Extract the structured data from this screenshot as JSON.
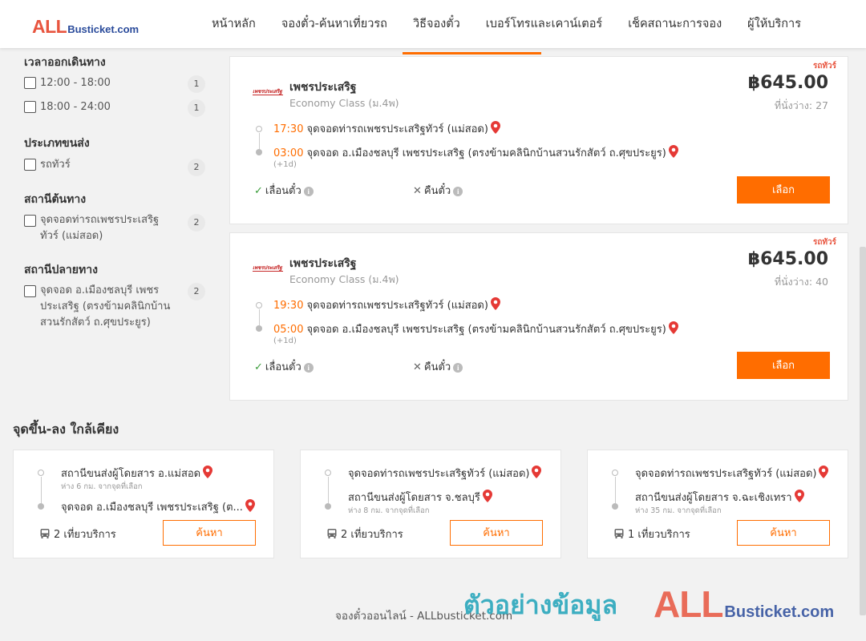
{
  "header": {
    "logo_all": "ALL",
    "logo_rest": "Busticket.com",
    "nav": [
      "หน้าหลัก",
      "จองตั๋ว-ค้นหาเที่ยวรถ",
      "วิธีจองตั๋ว",
      "เบอร์โทรและเคาน์เตอร์",
      "เช็คสถานะการจอง",
      "ผู้ให้บริการ"
    ]
  },
  "filters": {
    "departure_time": {
      "title": "เวลาออกเดินทาง",
      "options": [
        {
          "label": "12:00 - 18:00",
          "count": "1"
        },
        {
          "label": "18:00 - 24:00",
          "count": "1"
        }
      ]
    },
    "vehicle_type": {
      "title": "ประเภทขนส่ง",
      "options": [
        {
          "label": "รถทัวร์",
          "count": "2"
        }
      ]
    },
    "origin": {
      "title": "สถานีต้นทาง",
      "options": [
        {
          "label": "จุดจอดท่ารถเพชรประเสริฐทัวร์ (แม่สอด)",
          "count": "2"
        }
      ]
    },
    "destination": {
      "title": "สถานีปลายทาง",
      "options": [
        {
          "label": "จุดจอด อ.เมืองชลบุรี เพชรประเสริฐ (ตรงข้ามคลินิกบ้านสวนรักสัตว์ ถ.ศุขประยูร)",
          "count": "2"
        }
      ]
    }
  },
  "trips": [
    {
      "badge": "รถทัวร์",
      "operator_logo": "เพชรประเสริฐ",
      "operator": "เพชรประเสริฐ",
      "bus_class": "Economy Class (ม.4พ)",
      "price": "฿645.00",
      "seats": "ที่นั่งว่าง: 27",
      "depart_time": "17:30",
      "depart_stop": "จุดจอดท่ารถเพชรประเสริฐทัวร์ (แม่สอด)",
      "arrive_time": "03:00",
      "arrive_stop": "จุดจอด อ.เมืองชลบุรี เพชรประเสริฐ (ตรงข้ามคลินิกบ้านสวนรักสัตว์ ถ.ศุขประยูร)",
      "plus_day": "(+1d)",
      "reschedule": "เลื่อนตั๋ว",
      "refund": "คืนตั๋ว",
      "select": "เลือก"
    },
    {
      "badge": "รถทัวร์",
      "operator_logo": "เพชรประเสริฐ",
      "operator": "เพชรประเสริฐ",
      "bus_class": "Economy Class (ม.4พ)",
      "price": "฿645.00",
      "seats": "ที่นั่งว่าง: 40",
      "depart_time": "19:30",
      "depart_stop": "จุดจอดท่ารถเพชรประเสริฐทัวร์ (แม่สอด)",
      "arrive_time": "05:00",
      "arrive_stop": "จุดจอด อ.เมืองชลบุรี เพชรประเสริฐ (ตรงข้ามคลินิกบ้านสวนรักสัตว์ ถ.ศุขประยูร)",
      "plus_day": "(+1d)",
      "reschedule": "เลื่อนตั๋ว",
      "refund": "คืนตั๋ว",
      "select": "เลือก"
    }
  ],
  "nearby": {
    "title": "จุดขึ้น-ลง ใกล้เคียง",
    "cards": [
      {
        "from": "สถานีขนส่งผู้โดยสาร อ.แม่สอด",
        "from_dist": "ห่าง 6 กม. จากจุดที่เลือก",
        "to": "จุดจอด อ.เมืองชลบุรี เพชรประเสริฐ (ต...",
        "to_dist": "",
        "trips": "2 เที่ยวบริการ",
        "button": "ค้นหา"
      },
      {
        "from": "จุดจอดท่ารถเพชรประเสริฐทัวร์ (แม่สอด)",
        "from_dist": "",
        "to": "สถานีขนส่งผู้โดยสาร จ.ชลบุรี",
        "to_dist": "ห่าง 8 กม. จากจุดที่เลือก",
        "trips": "2 เที่ยวบริการ",
        "button": "ค้นหา"
      },
      {
        "from": "จุดจอดท่ารถเพชรประเสริฐทัวร์ (แม่สอด)",
        "from_dist": "",
        "to": "สถานีขนส่งผู้โดยสาร จ.ฉะเชิงเทรา",
        "to_dist": "ห่าง 35 กม. จากจุดที่เลือก",
        "trips": "1 เที่ยวบริการ",
        "button": "ค้นหา"
      }
    ]
  },
  "footer": {
    "text": "จองตั๋วออนไลน์ - ALLbusticket.com",
    "watermark_sample": "ตัวอย่างข้อมูล",
    "watermark_all": "ALL",
    "watermark_rest": "Busticket.com"
  },
  "colors": {
    "accent": "#ff6d00",
    "brand_red": "#e8553f",
    "brand_blue": "#2a4b9b",
    "pin_red": "#e53935"
  }
}
